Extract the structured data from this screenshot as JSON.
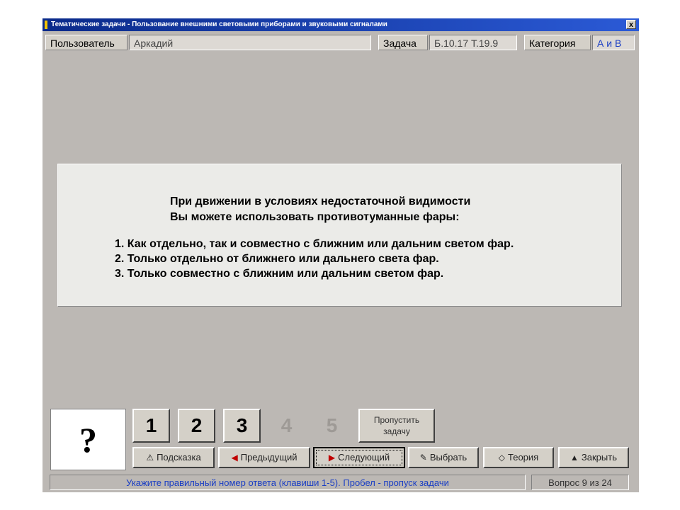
{
  "window": {
    "title": "Тематические задачи - Пользование внешними световыми приборами и звуковыми сигналами",
    "close_label": "x"
  },
  "infobar": {
    "user_label": "Пользователь",
    "user_value": "Аркадий",
    "task_label": "Задача",
    "task_value": "Б.10.17  Т.19.9",
    "category_label": "Категория",
    "category_value": "А и В"
  },
  "question": {
    "heading_line1": "При движении в условиях недостаточной видимости",
    "heading_line2": "Вы можете использовать противотуманные фары:",
    "answers": [
      "1. Как отдельно, так и совместно с ближним или дальним светом фар.",
      "2. Только отдельно от ближнего или дальнего света фар.",
      "3. Только совместно с ближним или дальним светом фар."
    ]
  },
  "answer_panel": {
    "indicator": "?",
    "numbers": [
      "1",
      "2",
      "3",
      "4",
      "5"
    ],
    "skip_line1": "Пропустить",
    "skip_line2": "задачу"
  },
  "nav_buttons": {
    "hint": "Подсказка",
    "prev": "Предыдущий",
    "next": "Следующий",
    "choose": "Выбрать",
    "theory": "Теория",
    "close": "Закрыть"
  },
  "statusbar": {
    "message": "Укажите правильный номер ответа (клавиши 1-5). Пробел - пропуск задачи",
    "counter": "Вопрос 9 из 24"
  }
}
